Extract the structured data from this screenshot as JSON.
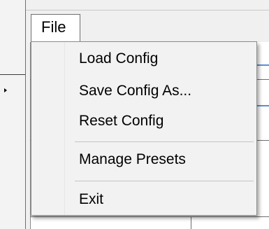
{
  "menubar": {
    "file_label": "File"
  },
  "file_menu": {
    "items": [
      {
        "label": "Load Config"
      },
      {
        "label": "Save Config As..."
      },
      {
        "label": "Reset Config"
      },
      {
        "label": "Manage Presets"
      },
      {
        "label": "Exit"
      }
    ]
  }
}
